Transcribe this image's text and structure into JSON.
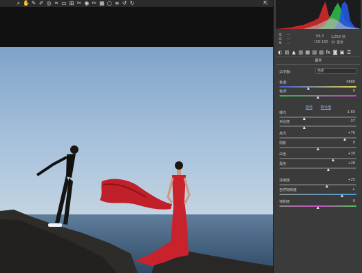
{
  "toolbar": {
    "tools": [
      {
        "name": "zoom-tool-icon",
        "glyph": "⌕"
      },
      {
        "name": "hand-tool-icon",
        "glyph": "✋"
      },
      {
        "name": "white-balance-tool-icon",
        "glyph": "✎"
      },
      {
        "name": "color-sampler-tool-icon",
        "glyph": "✐"
      },
      {
        "name": "target-adjustment-tool-icon",
        "glyph": "◎"
      },
      {
        "name": "crop-tool-icon",
        "glyph": "⌗"
      },
      {
        "name": "straighten-tool-icon",
        "glyph": "▭"
      },
      {
        "name": "transform-tool-icon",
        "glyph": "⊞"
      },
      {
        "name": "spot-removal-tool-icon",
        "glyph": "✂"
      },
      {
        "name": "red-eye-tool-icon",
        "glyph": "◉"
      },
      {
        "name": "adjustment-brush-icon",
        "glyph": "✏"
      },
      {
        "name": "graduated-filter-icon",
        "glyph": "▦"
      },
      {
        "name": "radial-filter-icon",
        "glyph": "○"
      },
      {
        "name": "preferences-icon",
        "glyph": "≡"
      },
      {
        "name": "rotate-left-icon",
        "glyph": "↺"
      },
      {
        "name": "rotate-right-icon",
        "glyph": "↻"
      }
    ],
    "preview_glyph": "⇱"
  },
  "panel": {
    "info": {
      "r": "R:",
      "r_val": "---",
      "g": "G:",
      "g_val": "---",
      "b": "B:",
      "b_val": "---",
      "aperture": "f/6.3",
      "shutter": "1/250 秒",
      "iso": "ISO 100",
      "focal": "35 毫米"
    },
    "tab_icons": [
      "◐",
      "▤",
      "▲",
      "▥",
      "▦",
      "▧",
      "▨",
      "fx",
      "◙",
      "▣",
      "☰"
    ],
    "title": "基本",
    "white_balance": {
      "label": "白平衡:",
      "value": "自定"
    },
    "auto_label": "自动",
    "default_label": "默认值",
    "sliders": [
      {
        "key": "temperature",
        "label": "色温",
        "value": "4800",
        "pos": 0.38,
        "track": "linear-gradient(to right, #3c5fd8, #e6d44a)"
      },
      {
        "key": "tint",
        "label": "色调",
        "value": "0",
        "pos": 0.5,
        "track": "linear-gradient(to right, #36b84c, #c642c4)"
      },
      {
        "key": "exposure",
        "label": "曝光",
        "value": "-1.65",
        "pos": 0.33,
        "track": "#6a6a6a"
      },
      {
        "key": "contrast",
        "label": "对比度",
        "value": "-37",
        "pos": 0.33,
        "track": "#6a6a6a"
      },
      {
        "key": "highlights",
        "label": "高光",
        "value": "+70",
        "pos": 0.85,
        "track": "#6a6a6a"
      },
      {
        "key": "shadows",
        "label": "阴影",
        "value": "0",
        "pos": 0.5,
        "track": "#6a6a6a"
      },
      {
        "key": "whites",
        "label": "白色",
        "value": "+39",
        "pos": 0.7,
        "track": "#6a6a6a"
      },
      {
        "key": "blacks",
        "label": "黑色",
        "value": "+28",
        "pos": 0.64,
        "track": "#6a6a6a"
      },
      {
        "key": "clarity",
        "label": "清晰度",
        "value": "+25",
        "pos": 0.62,
        "track": "#6a6a6a"
      },
      {
        "key": "vibrance",
        "label": "自然饱和度",
        "value": "+",
        "pos": 0.82,
        "track": "linear-gradient(to right, #8a8a8a, #4fa0e0)"
      },
      {
        "key": "saturation",
        "label": "饱和度",
        "value": "0",
        "pos": 0.5,
        "track": "linear-gradient(to right, #8a8a8a, #d048c8, #48c84a)"
      }
    ]
  }
}
